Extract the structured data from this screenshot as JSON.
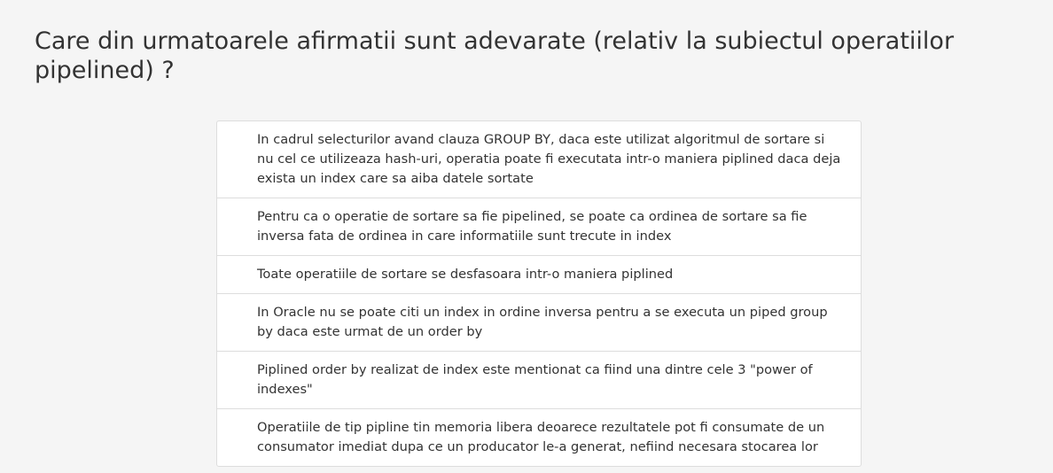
{
  "question": {
    "title": "Care din urmatoarele afirmatii sunt adevarate (relativ la subiectul operatiilor pipelined) ?"
  },
  "answers": [
    "In cadrul selecturilor avand clauza GROUP BY, daca este utilizat algoritmul de sortare si nu cel ce utilizeaza hash-uri, operatia poate fi executata intr-o maniera piplined daca deja exista un index care sa aiba datele sortate",
    "Pentru ca o operatie de sortare sa fie pipelined, se poate ca ordinea de sortare sa fie inversa fata de ordinea in care informatiile sunt trecute in index",
    "Toate operatiile de sortare se desfasoara intr-o maniera piplined",
    "In Oracle nu se poate citi un index in ordine inversa pentru a se executa un piped group by daca este urmat de un order by",
    "Piplined order by realizat de index este mentionat ca fiind una dintre cele 3 \"power of indexes\"",
    "Operatiile de tip pipline tin memoria libera deoarece rezultatele pot fi consumate de un consumator imediat dupa ce un producator le-a generat, nefiind necesara stocarea lor"
  ]
}
